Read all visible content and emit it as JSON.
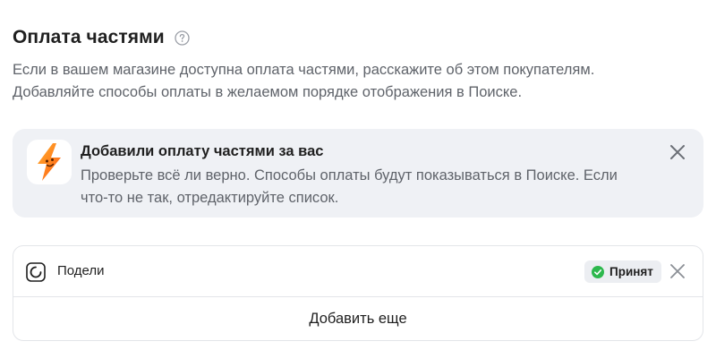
{
  "section": {
    "title": "Оплата частями",
    "description_lines": [
      "Если в вашем магазине доступна оплата частями, расскажите об этом покупателям.",
      "Добавляйте способы оплаты в желаемом порядке отображения в Поиске."
    ]
  },
  "notice": {
    "title": "Добавили оплату частями за вас",
    "text_lines": [
      "Проверьте всё ли верно. Способы оплаты будут показываться в Поиске. Если",
      "что-то не так, отредактируйте список."
    ]
  },
  "methods": [
    {
      "name": "Подели",
      "status": "Принят"
    }
  ],
  "add_more_label": "Добавить еще",
  "colors": {
    "status_accepted": "#2db84d",
    "notice_bg": "#eff1f5",
    "logo_orange": "#ff6a1a"
  }
}
